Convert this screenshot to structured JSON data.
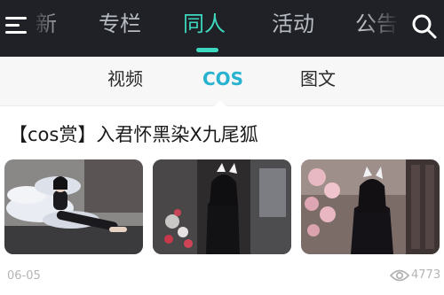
{
  "topbar": {
    "menu_icon": "menu-icon",
    "tabs": [
      {
        "label": "新"
      },
      {
        "label": "专栏"
      },
      {
        "label": "同人",
        "active": true
      },
      {
        "label": "活动"
      },
      {
        "label": "公告"
      }
    ],
    "search_icon": "search-icon",
    "accent_color": "#3dd9bf",
    "background_color": "#1f2126"
  },
  "subtabs": {
    "items": [
      {
        "label": "视频"
      },
      {
        "label": "COS",
        "active": true
      },
      {
        "label": "图文"
      }
    ],
    "active_color": "#27b2d0"
  },
  "article": {
    "title": "【cos赏】入君怀黑染X九尾狐",
    "images": [
      {
        "icon": "cosplay-photo-1"
      },
      {
        "icon": "cosplay-photo-2"
      },
      {
        "icon": "cosplay-photo-3"
      }
    ],
    "date": "06-05",
    "view_icon": "eye-icon",
    "views": "4773"
  }
}
